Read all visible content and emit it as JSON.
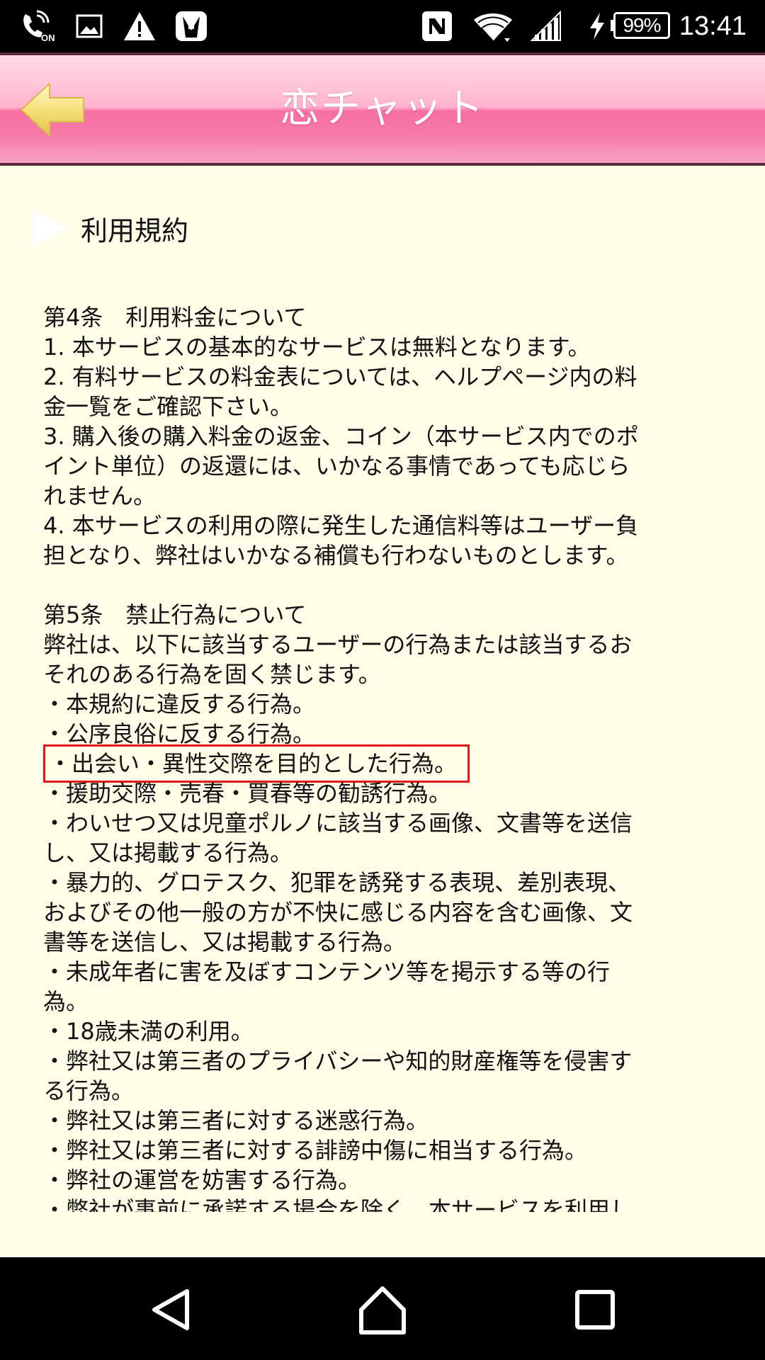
{
  "status_bar": {
    "time": "13:41",
    "battery": "99%",
    "icons": [
      "volte-on-icon",
      "image-icon",
      "warning-icon",
      "tuxedo-icon",
      "nfc-icon",
      "wifi-icon",
      "signal-icon",
      "charging-icon",
      "battery-icon"
    ]
  },
  "header": {
    "title": "恋チャット",
    "back_icon": "back-arrow-icon",
    "accent_colors": [
      "#ffc3d8",
      "#f76fa2"
    ]
  },
  "section": {
    "heading": "利用規約"
  },
  "terms": {
    "lines": [
      "第4条　利用料金について",
      "1. 本サービスの基本的なサービスは無料となります。",
      "2. 有料サービスの料金表については、ヘルプページ内の料",
      "金一覧をご確認下さい。",
      "3. 購入後の購入料金の返金、コイン（本サービス内でのポ",
      "イント単位）の返還には、いかなる事情であっても応じら",
      "れません。",
      "4. 本サービスの利用の際に発生した通信料等はユーザー負",
      "担となり、弊社はいかなる補償も行わないものとします。",
      "",
      "第5条　禁止行為について",
      "弊社は、以下に該当するユーザーの行為または該当するお",
      "それのある行為を固く禁じます。",
      "・本規約に違反する行為。",
      "・公序良俗に反する行為。",
      "・出会い・異性交際を目的とした行為。",
      "・援助交際・売春・買春等の勧誘行為。",
      "・わいせつ又は児童ポルノに該当する画像、文書等を送信",
      "し、又は掲載する行為。",
      "・暴力的、グロテスク、犯罪を誘発する表現、差別表現、",
      "およびその他一般の方が不快に感じる内容を含む画像、文",
      "書等を送信し、又は掲載する行為。",
      "・未成年者に害を及ぼすコンテンツ等を掲示する等の行",
      "為。",
      "・18歳未満の利用。",
      "・弊社又は第三者のプライバシーや知的財産権等を侵害す",
      "る行為。",
      "・弊社又は第三者に対する迷惑行為。",
      "・弊社又は第三者に対する誹謗中傷に相当する行為。",
      "・弊社の運営を妨害する行為。",
      "・弊社が事前に承諾する場合を除く、本サービスを利用し"
    ],
    "highlighted_line": "・出会い・異性交際を目的とした行為。",
    "highlight_color": "#e01818"
  },
  "nav_bar": {
    "icons": [
      "back-triangle-icon",
      "home-icon",
      "recents-square-icon"
    ]
  }
}
